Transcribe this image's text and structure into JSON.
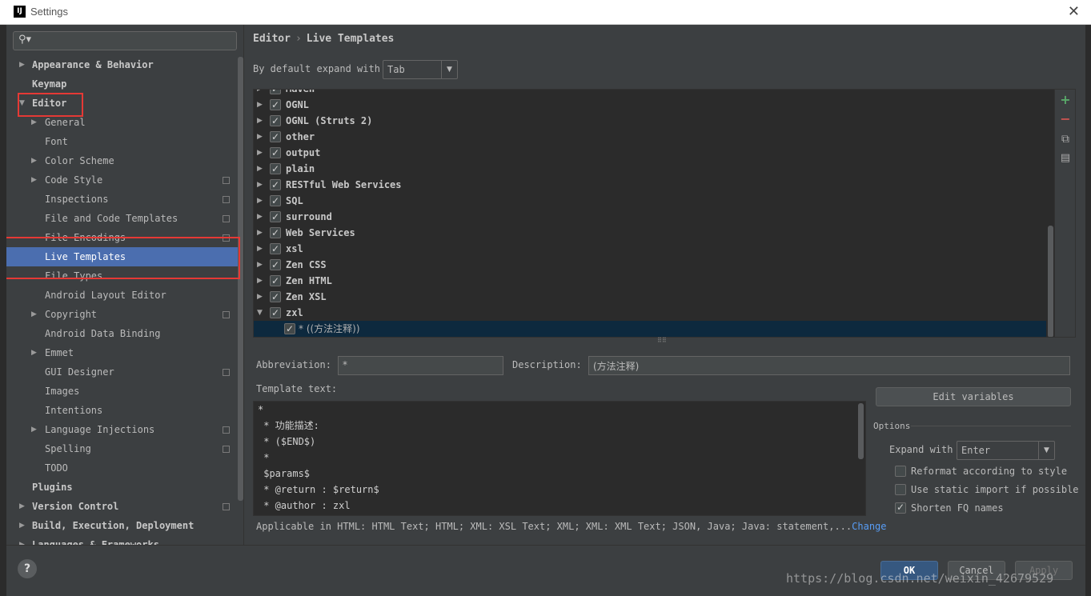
{
  "window": {
    "title": "Settings",
    "app_icon": "IJ",
    "close_glyph": "✕"
  },
  "search": {
    "placeholder": "",
    "icon": "search-icon"
  },
  "sidebar": {
    "items": [
      {
        "label": "Appearance & Behavior",
        "expander": "▶"
      },
      {
        "label": "Keymap"
      },
      {
        "label": "Editor",
        "expander": "▼"
      },
      {
        "label": "General",
        "expander": "▶"
      },
      {
        "label": "Font"
      },
      {
        "label": "Color Scheme",
        "expander": "▶"
      },
      {
        "label": "Code Style",
        "expander": "▶"
      },
      {
        "label": "Inspections"
      },
      {
        "label": "File and Code Templates"
      },
      {
        "label": "File Encodings"
      },
      {
        "label": "Live Templates"
      },
      {
        "label": "File Types"
      },
      {
        "label": "Android Layout Editor"
      },
      {
        "label": "Copyright",
        "expander": "▶"
      },
      {
        "label": "Android Data Binding"
      },
      {
        "label": "Emmet",
        "expander": "▶"
      },
      {
        "label": "GUI Designer"
      },
      {
        "label": "Images"
      },
      {
        "label": "Intentions"
      },
      {
        "label": "Language Injections",
        "expander": "▶"
      },
      {
        "label": "Spelling"
      },
      {
        "label": "TODO"
      },
      {
        "label": "Plugins"
      },
      {
        "label": "Version Control",
        "expander": "▶"
      },
      {
        "label": "Build, Execution, Deployment",
        "expander": "▶"
      },
      {
        "label": "Languages & Frameworks",
        "expander": "▶"
      }
    ]
  },
  "breadcrumb": {
    "parent": "Editor",
    "separator": "›",
    "current": "Live Templates"
  },
  "expand_default": {
    "label": "By default expand with",
    "value": "Tab",
    "arrow": "▼"
  },
  "templates": {
    "groups": [
      {
        "name": "Maven",
        "expander": "▶"
      },
      {
        "name": "OGNL",
        "expander": "▶"
      },
      {
        "name": "OGNL (Struts 2)",
        "expander": "▶"
      },
      {
        "name": "other",
        "expander": "▶"
      },
      {
        "name": "output",
        "expander": "▶"
      },
      {
        "name": "plain",
        "expander": "▶"
      },
      {
        "name": "RESTful Web Services",
        "expander": "▶"
      },
      {
        "name": "SQL",
        "expander": "▶"
      },
      {
        "name": "surround",
        "expander": "▶"
      },
      {
        "name": "Web Services",
        "expander": "▶"
      },
      {
        "name": "xsl",
        "expander": "▶"
      },
      {
        "name": "Zen CSS",
        "expander": "▶"
      },
      {
        "name": "Zen HTML",
        "expander": "▶"
      },
      {
        "name": "Zen XSL",
        "expander": "▶"
      },
      {
        "name": "zxl",
        "expander": "▼"
      }
    ],
    "selected_child": "* ((方法注释))"
  },
  "toolbar": {
    "add": "+",
    "remove": "−",
    "copy": "⧉",
    "edit": "▤"
  },
  "abbreviation": {
    "label": "Abbreviation:",
    "value": "*"
  },
  "description": {
    "label": "Description:",
    "value": "(方法注释)"
  },
  "template_text": {
    "label": "Template text:",
    "lines": [
      "*",
      " * 功能描述:",
      " * ($END$)",
      " *",
      " $params$",
      " * @return : $return$",
      " * @author : zxl"
    ]
  },
  "edit_variables": "Edit variables",
  "options": {
    "title": "Options",
    "expand_with_label": "Expand with",
    "expand_with_value": "Enter",
    "reformat": "Reformat according to style",
    "static_import": "Use static import if possible",
    "shorten_fq": "Shorten FQ names"
  },
  "applicable": {
    "text": "Applicable in HTML: HTML Text; HTML; XML: XSL Text; XML; XML: XML Text; JSON, Java; Java: statement,...",
    "link": "Change"
  },
  "buttons": {
    "ok": "OK",
    "cancel": "Cancel",
    "apply": "Apply",
    "help": "?"
  },
  "watermark": "https://blog.csdn.net/weixin_42679529"
}
